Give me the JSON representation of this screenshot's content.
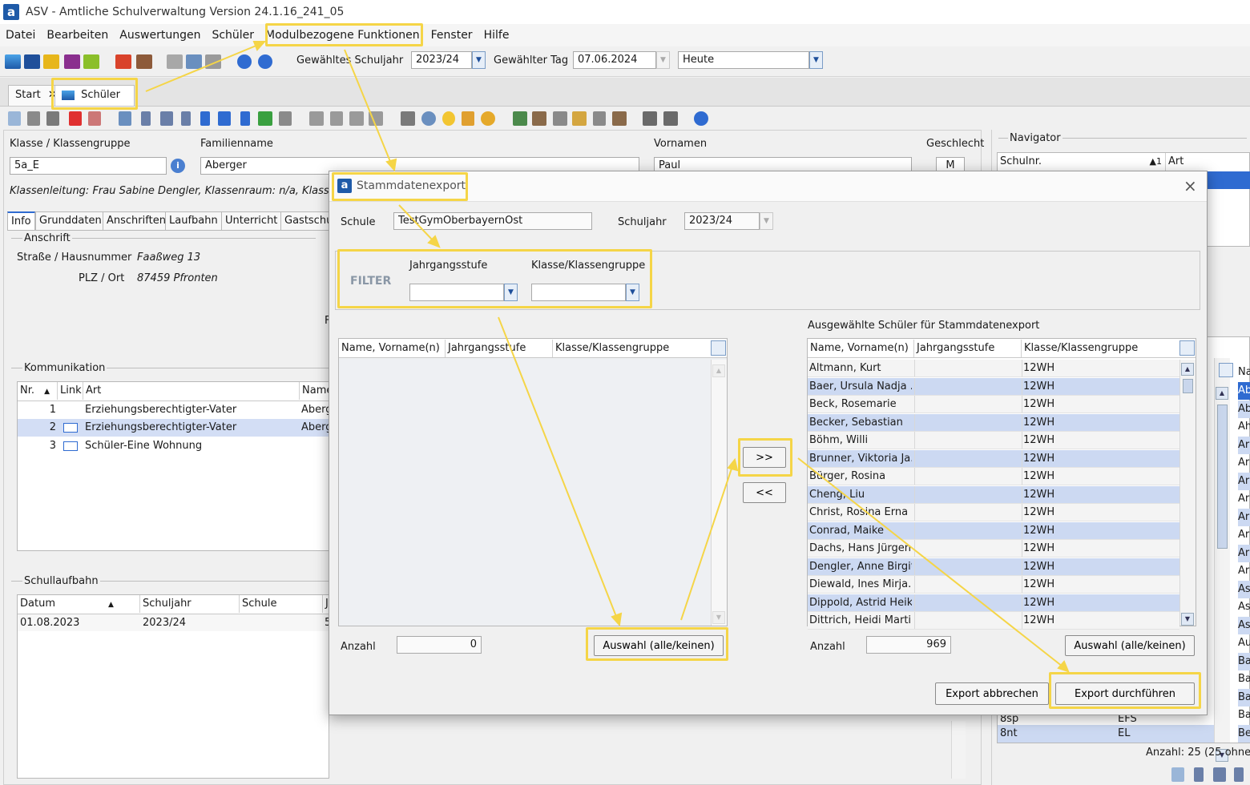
{
  "window": {
    "title": "ASV - Amtliche Schulverwaltung Version 24.1.16_241_05",
    "logo": "a"
  },
  "menu": [
    "Datei",
    "Bearbeiten",
    "Auswertungen",
    "Schüler",
    "Modulbezogene Funktionen",
    "Fenster",
    "Hilfe"
  ],
  "toolbar": {
    "schuljahr_label": "Gewähltes Schuljahr",
    "schuljahr_value": "2023/24",
    "tag_label": "Gewählter Tag",
    "tag_value": "07.06.2024",
    "heute_value": "Heute"
  },
  "tabs": [
    {
      "label": "Start"
    },
    {
      "label": "Schüler"
    }
  ],
  "student": {
    "klasse_label": "Klasse / Klassengruppe",
    "klasse_value": "5a_E",
    "familienname_label": "Familienname",
    "familienname_value": "Aberger",
    "vornamen_label": "Vornamen",
    "vornamen_value": "Paul",
    "geschlecht_label": "Geschlecht",
    "geschlecht_value": "M",
    "klassenleitung_text": "Klassenleitung: Frau Sabine Dengler, Klassenraum: n/a, Klassenc"
  },
  "subtabs": [
    "Info",
    "Grunddaten",
    "Anschriften",
    "Laufbahn",
    "Unterricht",
    "Gastschu"
  ],
  "anschrift": {
    "group_label": "Anschrift",
    "strasse_label": "Straße / Hausnummer",
    "strasse_value": "Faaßweg 13",
    "plz_label": "PLZ / Ort",
    "plz_value": "87459 Pfronten",
    "stray": "F"
  },
  "kommunikation": {
    "group_label": "Kommunikation",
    "headers": [
      "Nr.",
      "Link",
      "Art",
      "Name"
    ],
    "rows": [
      {
        "nr": "1",
        "art": "Erziehungsberechtigter-Vater",
        "name": "Aberg"
      },
      {
        "nr": "2",
        "art": "Erziehungsberechtigter-Vater",
        "name": "Aberg"
      },
      {
        "nr": "3",
        "art": "Schüler-Eine Wohnung",
        "name": ""
      }
    ]
  },
  "schullaufbahn": {
    "group_label": "Schullaufbahn",
    "headers": [
      "Datum",
      "Schuljahr",
      "Schule",
      "J"
    ],
    "rows": [
      {
        "datum": "01.08.2023",
        "schuljahr": "2023/24",
        "schule": "",
        "j": "5"
      }
    ]
  },
  "navigator": {
    "title": "Navigator",
    "headers": [
      "Schulnr.",
      "1",
      "Art"
    ],
    "lower_header": "Na",
    "lower_rows": [
      "Ab",
      "Ab",
      "Ah",
      "Ar",
      "Ar",
      "Ar",
      "Ar",
      "Ar",
      "Ar",
      "Ar",
      "Ar",
      "As",
      "As",
      "As",
      "Au",
      "Ba",
      "Ba",
      "Ba",
      "Ba",
      "Be"
    ],
    "bottom_rows": [
      {
        "a": "8sp",
        "b": "EFS"
      },
      {
        "a": "8nt",
        "b": "EL"
      }
    ],
    "anzahl_text": "Anzahl: 25 (25 ohne A"
  },
  "dialog": {
    "title": "Stammdatenexport",
    "schule_label": "Schule",
    "schule_value": "TestGymOberbayernOst",
    "schuljahr_label": "Schuljahr",
    "schuljahr_value": "2023/24",
    "filter_label": "FILTER",
    "jahrgang_label": "Jahrgangsstufe",
    "klasse_label": "Klasse/Klassengruppe",
    "left_headers": [
      "Name, Vorname(n)",
      "Jahrgangsstufe",
      "Klasse/Klassengruppe"
    ],
    "right_title": "Ausgewählte Schüler für Stammdatenexport",
    "right_headers": [
      "Name, Vorname(n)",
      "Jahrgangsstufe",
      "Klasse/Klassengruppe"
    ],
    "right_rows": [
      {
        "name": "Altmann, Kurt",
        "jg": "",
        "kl": "12WH"
      },
      {
        "name": "Baer, Ursula Nadja ...",
        "jg": "",
        "kl": "12WH"
      },
      {
        "name": "Beck, Rosemarie",
        "jg": "",
        "kl": "12WH"
      },
      {
        "name": "Becker, Sebastian",
        "jg": "",
        "kl": "12WH"
      },
      {
        "name": "Böhm, Willi",
        "jg": "",
        "kl": "12WH"
      },
      {
        "name": "Brunner, Viktoria Ja...",
        "jg": "",
        "kl": "12WH"
      },
      {
        "name": "Bürger, Rosina",
        "jg": "",
        "kl": "12WH"
      },
      {
        "name": "Cheng, Liu",
        "jg": "",
        "kl": "12WH"
      },
      {
        "name": "Christ, Rosina Erna ...",
        "jg": "",
        "kl": "12WH"
      },
      {
        "name": "Conrad, Maike",
        "jg": "",
        "kl": "12WH"
      },
      {
        "name": "Dachs, Hans Jürgen",
        "jg": "",
        "kl": "12WH"
      },
      {
        "name": "Dengler, Anne Birgit...",
        "jg": "",
        "kl": "12WH"
      },
      {
        "name": "Diewald, Ines Mirja...",
        "jg": "",
        "kl": "12WH"
      },
      {
        "name": "Dippold, Astrid Heik...",
        "jg": "",
        "kl": "12WH"
      },
      {
        "name": "Dittrich, Heidi Marti...",
        "jg": "",
        "kl": "12WH"
      }
    ],
    "move_right": ">>",
    "move_left": "<<",
    "anzahl_label": "Anzahl",
    "left_count": "0",
    "right_count": "969",
    "auswahl_left": "Auswahl (alle/keinen)",
    "auswahl_right": "Auswahl (alle/keinen)",
    "cancel_label": "Export abbrechen",
    "export_label": "Export durchführen"
  },
  "colors": {
    "accent": "#1e5aa8",
    "highlight": "#f5d547",
    "row_alt": "#ccd9f2",
    "row_sel": "#d3def5"
  }
}
